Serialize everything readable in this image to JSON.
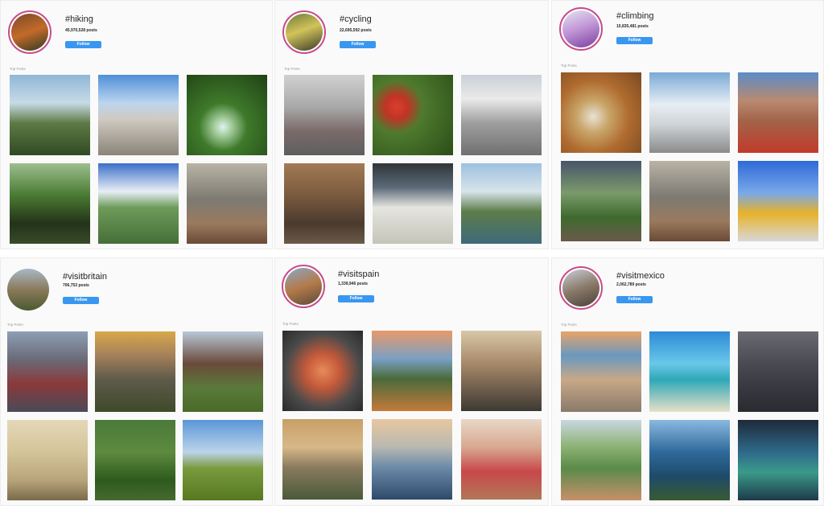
{
  "panels": [
    {
      "tag": "#hiking",
      "posts": "45,970,528 posts",
      "follow": "Follow",
      "top_label": "Top Posts",
      "avatar": "linear-gradient(160deg,#7a4a2a,#c46a2a 50%,#2e3a22)",
      "tiles": [
        "linear-gradient(180deg,#8fb6d8 0%,#c8dbe6 35%,#5e7a45 60%,#2f4a24 100%)",
        "linear-gradient(180deg,#4f8fd8 0%,#bcd5ee 35%,#cfcac2 55%,#8b8477 100%)",
        "radial-gradient(circle at 45% 65%,#dff2f6 0%,#a7cfa0 12%,#3f7a2b 35%,#1f4114 100%)",
        "linear-gradient(180deg,#9bbf8e 0%,#4a7a32 40%,#23331a 75%,#394a2a 100%)",
        "linear-gradient(180deg,#3b6fc8 0%,#e8eef6 35%,#6d9c5a 55%,#466e38 100%)",
        "linear-gradient(180deg,#b9b3a6 0%,#7d7a72 45%,#9a7a5e 75%,#6a4a36 100%)"
      ]
    },
    {
      "tag": "#cycling",
      "posts": "22,695,592 posts",
      "follow": "Follow",
      "top_label": "Top Posts",
      "avatar": "linear-gradient(160deg,#6b7c3a,#d2c35a 45%,#3a3a2a)",
      "tiles": [
        "linear-gradient(180deg,#d0d0d0 0%,#a9a9a9 40%,#7b6a6a 70%,#5e5e5e 100%)",
        "radial-gradient(circle at 30% 40%,#d8412a 0%,#c23326 15%,#4f7a2e 35%,#2a4d18 100%)",
        "linear-gradient(180deg,#c9d0d6 0%,#eaeaea 30%,#9e9e9e 60%,#707070 100%)",
        "linear-gradient(180deg,#a27a54 0%,#7a5a3e 40%,#4a3a2e 75%,#6b5a4a 100%)",
        "linear-gradient(180deg,#2e3538 0%,#5b6a78 30%,#e5e5e0 55%,#c4c4b8 100%)",
        "linear-gradient(180deg,#9dc0e0 0%,#d8e4ea 35%,#5d7d4a 60%,#3f6a7a 100%)"
      ]
    },
    {
      "tag": "#climbing",
      "posts": "10,835,481 posts",
      "follow": "Follow",
      "top_label": "Top Posts",
      "avatar": "linear-gradient(160deg,#e3e6ef,#c49ad8 45%,#7a3ea0)",
      "tiles": [
        "radial-gradient(circle at 40% 55%,#e8e2d4 0%,#c8a468 25%,#b06b2f 55%,#7a4a22 100%)",
        "linear-gradient(180deg,#7aa9d6 0%,#e7eef4 40%,#cfd3d6 65%,#8a8a8a 100%)",
        "linear-gradient(180deg,#5a8cc8 0%,#b98a70 35%,#a2644a 60%,#c23a2a 100%)",
        "linear-gradient(180deg,#48556a 0%,#7a9a6a 40%,#3e6a2e 70%,#6a5a4a 100%)",
        "linear-gradient(180deg,#b9b3a6 0%,#7d7a72 45%,#9a7a5e 75%,#6a4a36 100%)",
        "linear-gradient(180deg,#2e6ad8 0%,#7aa8e8 40%,#e7b22a 65%,#d8d8d8 100%)"
      ]
    },
    {
      "tag": "#visitbritain",
      "posts": "706,753 posts",
      "follow": "Follow",
      "top_label": "Top Posts",
      "avatar": "linear-gradient(180deg,#a8b8c8,#8a7a5a 50%,#4a5a32)",
      "plain": true,
      "tiles": [
        "linear-gradient(180deg,#8e9fb5 0%,#6a6a78 35%,#8a3a3a 65%,#4a4a58 100%)",
        "linear-gradient(180deg,#d8a84a 0%,#a4805a 30%,#5e5a4a 60%,#3e4a2a 100%)",
        "linear-gradient(180deg,#b8c8d8 0%,#6a4a3a 40%,#5a7a3a 70%,#4a6a2a 100%)",
        "linear-gradient(180deg,#e4d8b8 0%,#d4c49a 40%,#b8a47a 75%,#7a6a4a 100%)",
        "linear-gradient(180deg,#4a7a3a 0%,#5e8a3e 40%,#2e5a1e 75%,#466a30 100%)",
        "linear-gradient(180deg,#5a96d8 0%,#bcd4ea 40%,#7a9a3e 60%,#56781e 100%)"
      ]
    },
    {
      "tag": "#visitspain",
      "posts": "1,339,946 posts",
      "follow": "Follow",
      "top_label": "Top Posts",
      "avatar": "linear-gradient(160deg,#8aa8c8,#b47a4a 50%,#5a4a3a)",
      "tiles": [
        "radial-gradient(circle at 50% 50%,#e88a5a 0%,#c45a3a 30%,#4a4a4a 65%,#2a2a2a 100%)",
        "linear-gradient(180deg,#e89a6a 0%,#7aa0c4 35%,#4a6a3a 60%,#c47a3a 100%)",
        "linear-gradient(180deg,#d8c8a8 0%,#a88a6a 40%,#6a5a4a 75%,#3e3a32 100%)",
        "linear-gradient(180deg,#c8a068 0%,#d8b888 35%,#8a7a5e 60%,#4a5a3a 100%)",
        "linear-gradient(180deg,#e8c8a0 0%,#b8b8b0 35%,#6a8aa8 60%,#2e4a6a 100%)",
        "linear-gradient(180deg,#e8d8c8 0%,#d8a890 35%,#c8484a 65%,#b07858 100%)"
      ]
    },
    {
      "tag": "#visitmexico",
      "posts": "2,062,789 posts",
      "follow": "Follow",
      "top_label": "Top Posts",
      "avatar": "linear-gradient(160deg,#c8d0d8,#8a7a6a 50%,#4a4038)",
      "tiles": [
        "linear-gradient(180deg,#e8a468 0%,#6a98c0 30%,#c8a888 60%,#8a7a6a 100%)",
        "linear-gradient(180deg,#2e8ad8 0%,#6ac8e8 40%,#2ea8b8 60%,#e8e0c8 100%)",
        "linear-gradient(180deg,#6a6a72 0%,#4a4a52 40%,#383840 70%,#2a2a30 100%)",
        "linear-gradient(180deg,#c8d8e0 0%,#8ab070 35%,#5a8a4a 60%,#c8906a 100%)",
        "linear-gradient(180deg,#8ab8e0 0%,#2e6a9a 40%,#1e4a6a 70%,#3a5a32 100%)",
        "linear-gradient(180deg,#1e2a3a 0%,#2e6a8a 40%,#3a9a8a 65%,#1e3a4a 100%)"
      ]
    }
  ]
}
